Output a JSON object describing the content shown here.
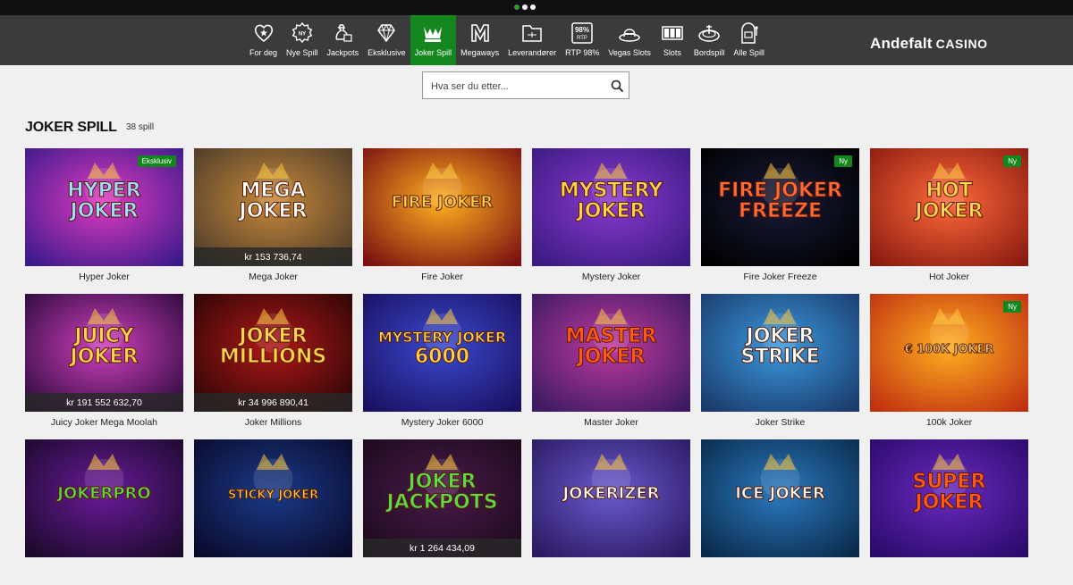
{
  "nav": {
    "items": [
      {
        "label": "For deg",
        "icon": "heart-star-icon"
      },
      {
        "label": "Nye Spill",
        "icon": "new-badge-icon"
      },
      {
        "label": "Jackpots",
        "icon": "money-bag-icon"
      },
      {
        "label": "Eksklusive",
        "icon": "diamond-icon"
      },
      {
        "label": "Joker Spill",
        "icon": "joker-crown-icon",
        "active": true
      },
      {
        "label": "Megaways",
        "icon": "megaways-icon"
      },
      {
        "label": "Leverandører",
        "icon": "provider-folder-icon"
      },
      {
        "label": "RTP 98%",
        "icon": "rtp-icon"
      },
      {
        "label": "Vegas Slots",
        "icon": "vegas-hat-icon"
      },
      {
        "label": "Slots",
        "icon": "slot-reels-icon"
      },
      {
        "label": "Bordspill",
        "icon": "roulette-icon"
      },
      {
        "label": "Alle Spill",
        "icon": "slot-machine-icon"
      }
    ],
    "rtp_icon_top": "98%",
    "rtp_icon_bottom": "RTP",
    "new_icon_text": "NY"
  },
  "logo": {
    "brand": "Andefalt",
    "suffix": "CASINO"
  },
  "search": {
    "placeholder": "Hva ser du etter..."
  },
  "section": {
    "title": "JOKER SPILL",
    "count": "38 spill"
  },
  "games": [
    {
      "name": "Hyper Joker",
      "thumb_title": "HYPER\nJOKER",
      "jackpot": "",
      "badge": "Eksklusiv",
      "bg": [
        "#e03bc0",
        "#3a1a8a"
      ],
      "accent": "#9fdcff"
    },
    {
      "name": "Mega Joker",
      "thumb_title": "MEGA\nJOKER",
      "jackpot": "kr 153 736,74",
      "badge": "",
      "bg": [
        "#c98a3a",
        "#4a3a2a"
      ],
      "accent": "#ffffff"
    },
    {
      "name": "Fire Joker",
      "thumb_title": "FIRE JOKER",
      "jackpot": "",
      "badge": "",
      "bg": [
        "#ffb020",
        "#7a1010"
      ],
      "accent": "#ffd34d"
    },
    {
      "name": "Mystery Joker",
      "thumb_title": "MYSTERY\nJOKER",
      "jackpot": "",
      "badge": "",
      "bg": [
        "#8a3ad0",
        "#3a1a80"
      ],
      "accent": "#ffd34d"
    },
    {
      "name": "Fire Joker Freeze",
      "thumb_title": "FIRE JOKER\nFREEZE",
      "jackpot": "",
      "badge": "Ny",
      "bg": [
        "#1a1a3a",
        "#000000"
      ],
      "accent": "#ff6a3a"
    },
    {
      "name": "Hot Joker",
      "thumb_title": "HOT\nJOKER",
      "jackpot": "",
      "badge": "Ny",
      "bg": [
        "#ff6a3a",
        "#8a1a10"
      ],
      "accent": "#ffd34d"
    },
    {
      "name": "Juicy Joker Mega Moolah",
      "thumb_title": "JUICY\nJOKER",
      "jackpot": "kr 191 552 632,70",
      "badge": "",
      "bg": [
        "#d040c0",
        "#2a0a3a"
      ],
      "accent": "#ffd34d"
    },
    {
      "name": "Joker Millions",
      "thumb_title": "JOKER\nMILLIONS",
      "jackpot": "kr 34 996 890,41",
      "badge": "",
      "bg": [
        "#b01818",
        "#2a0505"
      ],
      "accent": "#ffd34d"
    },
    {
      "name": "Mystery Joker 6000",
      "thumb_title": "MYSTERY JOKER\n6000",
      "jackpot": "",
      "badge": "",
      "bg": [
        "#3a4ad0",
        "#1a1060"
      ],
      "accent": "#ffd34d"
    },
    {
      "name": "Master Joker",
      "thumb_title": "MASTER\nJOKER",
      "jackpot": "",
      "badge": "",
      "bg": [
        "#c03aa0",
        "#3a1a60"
      ],
      "accent": "#ff5a1a"
    },
    {
      "name": "Joker Strike",
      "thumb_title": "JOKER\nSTRIKE",
      "jackpot": "",
      "badge": "",
      "bg": [
        "#3a9ae0",
        "#1a3a6a"
      ],
      "accent": "#ffffff"
    },
    {
      "name": "100k Joker",
      "thumb_title": "€ 100K JOKER",
      "jackpot": "",
      "badge": "Ny",
      "bg": [
        "#ffb020",
        "#c03010"
      ],
      "accent": "#ffe08a"
    },
    {
      "name": "",
      "thumb_title": "JOKERPRO",
      "jackpot": "",
      "badge": "",
      "bg": [
        "#6a1a9a",
        "#1a0a2a"
      ],
      "accent": "#5adc4a"
    },
    {
      "name": "",
      "thumb_title": "STICKY JOKER",
      "jackpot": "",
      "badge": "",
      "bg": [
        "#1a3a8a",
        "#0a0a2a"
      ],
      "accent": "#ffd34d"
    },
    {
      "name": "",
      "thumb_title": "JOKER\nJACKPOTS",
      "jackpot": "kr 1 264 434,09",
      "badge": "",
      "bg": [
        "#4a1a4a",
        "#1a0a1a"
      ],
      "accent": "#5adc4a"
    },
    {
      "name": "",
      "thumb_title": "JOKERIZER",
      "jackpot": "",
      "badge": "",
      "bg": [
        "#6a5ad0",
        "#2a1a60"
      ],
      "accent": "#ffffff"
    },
    {
      "name": "",
      "thumb_title": "ICE JOKER",
      "jackpot": "",
      "badge": "",
      "bg": [
        "#2a7ac0",
        "#0a2a4a"
      ],
      "accent": "#ffffff"
    },
    {
      "name": "",
      "thumb_title": "SUPER\nJOKER",
      "jackpot": "",
      "badge": "",
      "bg": [
        "#6a2ac0",
        "#2a0a6a"
      ],
      "accent": "#ff5a1a"
    }
  ]
}
